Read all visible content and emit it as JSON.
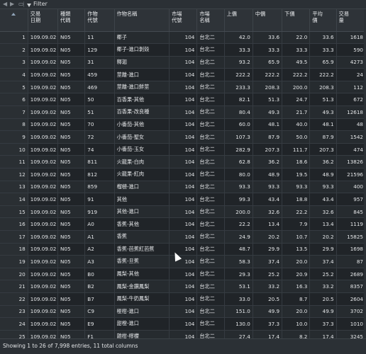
{
  "toolbar": {
    "back_icon": "back-arrow-icon",
    "forward_icon": "forward-arrow-icon",
    "popout_icon": "popout-icon",
    "filter_label": "Filter"
  },
  "columns": [
    {
      "line1": "交易",
      "line2": "日期"
    },
    {
      "line1": "種類",
      "line2": "代碼"
    },
    {
      "line1": "作物",
      "line2": "代號"
    },
    {
      "line1": "作物名稱",
      "line2": ""
    },
    {
      "line1": "市場",
      "line2": "代號"
    },
    {
      "line1": "市場",
      "line2": "名稱"
    },
    {
      "line1": "上價",
      "line2": ""
    },
    {
      "line1": "中價",
      "line2": ""
    },
    {
      "line1": "下價",
      "line2": ""
    },
    {
      "line1": "平均",
      "line2": "價"
    },
    {
      "line1": "交易",
      "line2": "量"
    }
  ],
  "rows": [
    [
      "1",
      "109.09.02",
      "N05",
      "11",
      "椰子",
      "104",
      "台北二",
      "42.0",
      "33.6",
      "22.0",
      "33.6",
      "1618"
    ],
    [
      "2",
      "109.09.02",
      "N05",
      "129",
      "椰子-進口剝殼",
      "104",
      "台北二",
      "33.3",
      "33.3",
      "33.3",
      "33.3",
      "590"
    ],
    [
      "3",
      "109.09.02",
      "N05",
      "31",
      "釋迦",
      "104",
      "台北二",
      "93.2",
      "65.9",
      "49.5",
      "65.9",
      "4273"
    ],
    [
      "4",
      "109.09.02",
      "N05",
      "459",
      "莖離-進口",
      "104",
      "台北二",
      "222.2",
      "222.2",
      "222.2",
      "222.2",
      "24"
    ],
    [
      "5",
      "109.09.02",
      "N05",
      "469",
      "莖離-進口鮮莖",
      "104",
      "台北二",
      "233.3",
      "208.3",
      "200.0",
      "208.3",
      "112"
    ],
    [
      "6",
      "109.09.02",
      "N05",
      "50",
      "百香果-其他",
      "104",
      "台北二",
      "82.1",
      "51.3",
      "24.7",
      "51.3",
      "672"
    ],
    [
      "7",
      "109.09.02",
      "N05",
      "51",
      "百香果-改良種",
      "104",
      "台北二",
      "80.4",
      "49.3",
      "21.7",
      "49.3",
      "12618"
    ],
    [
      "8",
      "109.09.02",
      "N05",
      "70",
      "小番茄-其他",
      "104",
      "台北二",
      "60.0",
      "48.1",
      "40.0",
      "48.1",
      "48"
    ],
    [
      "9",
      "109.09.02",
      "N05",
      "72",
      "小番茄-聖女",
      "104",
      "台北二",
      "107.3",
      "87.9",
      "50.0",
      "87.9",
      "1542"
    ],
    [
      "10",
      "109.09.02",
      "N05",
      "74",
      "小番茄-玉女",
      "104",
      "台北二",
      "282.9",
      "207.3",
      "111.7",
      "207.3",
      "474"
    ],
    [
      "11",
      "109.09.02",
      "N05",
      "811",
      "火龍果-白肉",
      "104",
      "台北二",
      "62.8",
      "36.2",
      "18.6",
      "36.2",
      "13826"
    ],
    [
      "12",
      "109.09.02",
      "N05",
      "812",
      "火龍果-紅肉",
      "104",
      "台北二",
      "80.0",
      "48.9",
      "19.5",
      "48.9",
      "21596"
    ],
    [
      "13",
      "109.09.02",
      "N05",
      "859",
      "榴槤-進口",
      "104",
      "台北二",
      "93.3",
      "93.3",
      "93.3",
      "93.3",
      "400"
    ],
    [
      "14",
      "109.09.02",
      "N05",
      "91",
      "其他",
      "104",
      "台北二",
      "99.3",
      "43.4",
      "18.8",
      "43.4",
      "957"
    ],
    [
      "15",
      "109.09.02",
      "N05",
      "919",
      "其他-進口",
      "104",
      "台北二",
      "200.0",
      "32.6",
      "22.2",
      "32.6",
      "845"
    ],
    [
      "16",
      "109.09.02",
      "N05",
      "A0",
      "香蕉-其他",
      "104",
      "台北二",
      "22.2",
      "13.4",
      "7.9",
      "13.4",
      "1119"
    ],
    [
      "17",
      "109.09.02",
      "N05",
      "A1",
      "香蕉",
      "104",
      "台北二",
      "24.9",
      "20.2",
      "10.7",
      "20.2",
      "15825"
    ],
    [
      "18",
      "109.09.02",
      "N05",
      "A2",
      "香蕉-芭蕉紅芭蕉",
      "104",
      "台北二",
      "48.7",
      "29.9",
      "13.5",
      "29.9",
      "1698"
    ],
    [
      "19",
      "109.09.02",
      "N05",
      "A3",
      "香蕉-旦蕉",
      "104",
      "台北二",
      "58.3",
      "37.4",
      "20.0",
      "37.4",
      "87"
    ],
    [
      "20",
      "109.09.02",
      "N05",
      "B0",
      "鳳梨-其他",
      "104",
      "台北二",
      "29.3",
      "25.2",
      "20.9",
      "25.2",
      "2689"
    ],
    [
      "21",
      "109.09.02",
      "N05",
      "B2",
      "鳳梨-金鑽鳳梨",
      "104",
      "台北二",
      "53.1",
      "33.2",
      "16.3",
      "33.2",
      "8357"
    ],
    [
      "22",
      "109.09.02",
      "N05",
      "B7",
      "鳳梨-牛奶鳳梨",
      "104",
      "台北二",
      "33.0",
      "20.5",
      "8.7",
      "20.5",
      "2604"
    ],
    [
      "23",
      "109.09.02",
      "N05",
      "C9",
      "椪柑-進口",
      "104",
      "台北二",
      "151.0",
      "49.9",
      "20.0",
      "49.9",
      "3702"
    ],
    [
      "24",
      "109.09.02",
      "N05",
      "E9",
      "甜橙-進口",
      "104",
      "台北二",
      "130.0",
      "37.3",
      "10.0",
      "37.3",
      "1010"
    ],
    [
      "25",
      "109.09.02",
      "N05",
      "F1",
      "雜柑-檸檬",
      "104",
      "台北二",
      "27.4",
      "17.4",
      "8.2",
      "17.4",
      "3245"
    ]
  ],
  "status_text": "Showing 1 to 26 of 7,998 entries, 11 total columns"
}
